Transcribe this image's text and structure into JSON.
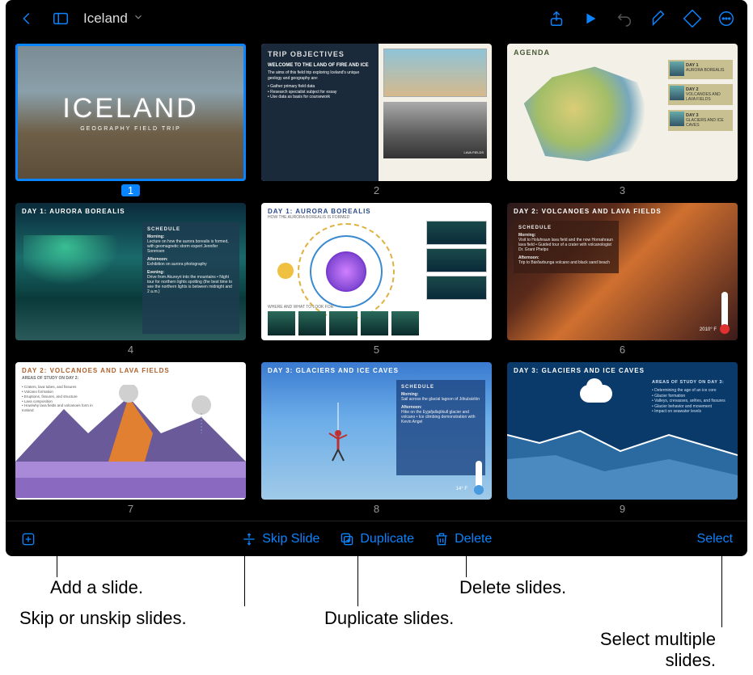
{
  "toolbar": {
    "doc_title": "Iceland"
  },
  "slides": [
    {
      "num": "1",
      "title": "ICELAND",
      "subtitle": "GEOGRAPHY FIELD TRIP"
    },
    {
      "num": "2",
      "header": "TRIP OBJECTIVES",
      "subhead": "WELCOME TO THE LAND OF FIRE AND ICE",
      "intro": "The aims of this field trip exploring Iceland's unique geology and geography are:",
      "bullets": [
        "Gather primary field data",
        "Research specialist subject for essay",
        "Use data as basis for coursework"
      ],
      "caption": "LAVA FIELDS"
    },
    {
      "num": "3",
      "header": "AGENDA",
      "items": [
        {
          "day": "DAY 1",
          "sub": "AURORA BOREALIS"
        },
        {
          "day": "DAY 2",
          "sub": "VOLCANOES AND LAVA FIELDS"
        },
        {
          "day": "DAY 3",
          "sub": "GLACIERS AND ICE CAVES"
        }
      ]
    },
    {
      "num": "4",
      "header": "DAY 1: AURORA BOREALIS",
      "panel_head": "SCHEDULE",
      "morning_h": "Morning:",
      "morning": "Lecture on how the aurora borealis is formed, with geomagnetic storm expert Jennifer Sorensen",
      "afternoon_h": "Afternoon:",
      "afternoon": "Exhibition on aurora photography",
      "evening_h": "Evening:",
      "evening": "Drive from Akureyri into the mountains • Night tour for northern lights spotting (the best time to see the northern lights is between midnight and 2 a.m.)"
    },
    {
      "num": "5",
      "header": "DAY 1: AURORA BOREALIS",
      "sub": "HOW THE AURORA BOREALIS IS FORMED",
      "caption": "WHERE AND WHAT TO LOOK FOR"
    },
    {
      "num": "6",
      "header": "DAY 2: VOLCANOES AND LAVA FIELDS",
      "panel_head": "SCHEDULE",
      "morning_h": "Morning:",
      "morning": "Visit to Holuhraun lava field and the now Hornahraun lava field • Guided tour of a crater with volcanologist Dr. Grant Phelps",
      "afternoon_h": "Afternoon:",
      "afternoon": "Trip to Bárðarbunga volcano and black sand beach",
      "temp": "2010° F"
    },
    {
      "num": "7",
      "header": "DAY 2: VOLCANOES AND LAVA FIELDS",
      "sub": "AREAS OF STUDY ON DAY 2:",
      "bullets": [
        "Craters, lava tubes, and fissures",
        "Volcano formation",
        "Eruptions, fissures, and structure",
        "Lava composition",
        "How/why lava fields and volcanoes form in Iceland"
      ]
    },
    {
      "num": "8",
      "header": "DAY 3: GLACIERS AND ICE CAVES",
      "panel_head": "SCHEDULE",
      "morning_h": "Morning:",
      "morning": "Sail across the glacial lagoon of Jökulsárlón",
      "afternoon_h": "Afternoon:",
      "afternoon": "Hike on the Eyjafjallajökull glacier and volcano • Ice climbing demonstration with Kevin Angel",
      "temp": "14° F"
    },
    {
      "num": "9",
      "header": "DAY 3: GLACIERS AND ICE CAVES",
      "sub": "AREAS OF STUDY ON DAY 3:",
      "bullets": [
        "Determining the age of an ice core",
        "Glacier formation",
        "Valleys, crevasses, arêtes, and fissures",
        "Glacier behavior and movement",
        "Impact on seawater levels"
      ]
    }
  ],
  "bottombar": {
    "skip": "Skip Slide",
    "duplicate": "Duplicate",
    "delete": "Delete",
    "select": "Select"
  },
  "callouts": {
    "add": "Add a slide.",
    "skip": "Skip or unskip slides.",
    "duplicate": "Duplicate slides.",
    "delete": "Delete slides.",
    "select": "Select multiple slides."
  }
}
